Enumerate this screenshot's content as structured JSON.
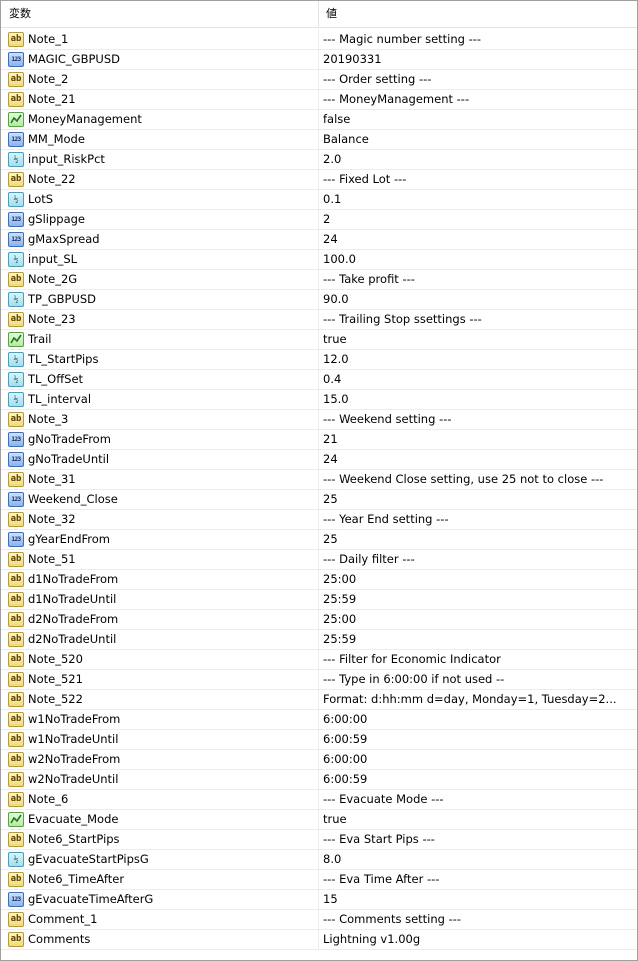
{
  "header": {
    "variable": "変数",
    "value": "値"
  },
  "rows": [
    {
      "name": "Note_1",
      "value": "--- Magic number setting ---",
      "type": "ab"
    },
    {
      "name": "MAGIC_GBPUSD",
      "value": "20190331",
      "type": "int"
    },
    {
      "name": "Note_2",
      "value": "--- Order setting ---",
      "type": "ab"
    },
    {
      "name": "Note_21",
      "value": "--- MoneyManagement  ---",
      "type": "ab"
    },
    {
      "name": "MoneyManagement",
      "value": "false",
      "type": "bool"
    },
    {
      "name": "MM_Mode",
      "value": "Balance",
      "type": "int"
    },
    {
      "name": "input_RiskPct",
      "value": "2.0",
      "type": "dbl"
    },
    {
      "name": "Note_22",
      "value": "--- Fixed Lot  ---",
      "type": "ab"
    },
    {
      "name": "LotS",
      "value": "0.1",
      "type": "dbl"
    },
    {
      "name": "gSlippage",
      "value": "2",
      "type": "int"
    },
    {
      "name": "gMaxSpread",
      "value": "24",
      "type": "int"
    },
    {
      "name": "input_SL",
      "value": "100.0",
      "type": "dbl"
    },
    {
      "name": "Note_2G",
      "value": "--- Take profit ---",
      "type": "ab"
    },
    {
      "name": "TP_GBPUSD",
      "value": "90.0",
      "type": "dbl"
    },
    {
      "name": "Note_23",
      "value": "--- Trailing Stop ssettings  ---",
      "type": "ab"
    },
    {
      "name": "Trail",
      "value": "true",
      "type": "bool"
    },
    {
      "name": "TL_StartPips",
      "value": "12.0",
      "type": "dbl"
    },
    {
      "name": "TL_OffSet",
      "value": "0.4",
      "type": "dbl"
    },
    {
      "name": "TL_interval",
      "value": "15.0",
      "type": "dbl"
    },
    {
      "name": "Note_3",
      "value": "---  Weekend setting ---",
      "type": "ab"
    },
    {
      "name": "gNoTradeFrom",
      "value": "21",
      "type": "int"
    },
    {
      "name": "gNoTradeUntil",
      "value": "24",
      "type": "int"
    },
    {
      "name": "Note_31",
      "value": "---  Weekend Close setting, use 25 not to close ---",
      "type": "ab"
    },
    {
      "name": "Weekend_Close",
      "value": "25",
      "type": "int"
    },
    {
      "name": "Note_32",
      "value": "--- Year End setting ---",
      "type": "ab"
    },
    {
      "name": "gYearEndFrom",
      "value": "25",
      "type": "int"
    },
    {
      "name": "Note_51",
      "value": "--- Daily filter  ---",
      "type": "ab"
    },
    {
      "name": "d1NoTradeFrom",
      "value": "25:00",
      "type": "ab"
    },
    {
      "name": "d1NoTradeUntil",
      "value": "25:59",
      "type": "ab"
    },
    {
      "name": "d2NoTradeFrom",
      "value": "25:00",
      "type": "ab"
    },
    {
      "name": "d2NoTradeUntil",
      "value": "25:59",
      "type": "ab"
    },
    {
      "name": "Note_520",
      "value": "--- Filter for Economic Indicator",
      "type": "ab"
    },
    {
      "name": "Note_521",
      "value": "--- Type in 6:00:00 if not used --",
      "type": "ab"
    },
    {
      "name": "Note_522",
      "value": "Format: d:hh:mm  d=day, Monday=1, Tuesday=2...",
      "type": "ab"
    },
    {
      "name": "w1NoTradeFrom",
      "value": "6:00:00",
      "type": "ab"
    },
    {
      "name": "w1NoTradeUntil",
      "value": "6:00:59",
      "type": "ab"
    },
    {
      "name": "w2NoTradeFrom",
      "value": "6:00:00",
      "type": "ab"
    },
    {
      "name": "w2NoTradeUntil",
      "value": "6:00:59",
      "type": "ab"
    },
    {
      "name": "Note_6",
      "value": "--- Evacuate Mode ---",
      "type": "ab"
    },
    {
      "name": "Evacuate_Mode",
      "value": "true",
      "type": "bool"
    },
    {
      "name": "Note6_StartPips",
      "value": "--- Eva Start Pips ---",
      "type": "ab"
    },
    {
      "name": "gEvacuateStartPipsG",
      "value": "8.0",
      "type": "dbl"
    },
    {
      "name": "Note6_TimeAfter",
      "value": "--- Eva Time After ---",
      "type": "ab"
    },
    {
      "name": "gEvacuateTimeAfterG",
      "value": "15",
      "type": "int"
    },
    {
      "name": "Comment_1",
      "value": "--- Comments setting ---",
      "type": "ab"
    },
    {
      "name": "Comments",
      "value": "Lightning v1.00g",
      "type": "ab"
    }
  ],
  "icons": {
    "ab": {
      "name": "string-icon",
      "glyph": "ab"
    },
    "int": {
      "name": "integer-icon",
      "glyph": "123"
    },
    "dbl": {
      "name": "double-icon",
      "glyph": "½"
    },
    "bool": {
      "name": "boolean-icon",
      "glyph": ""
    }
  }
}
